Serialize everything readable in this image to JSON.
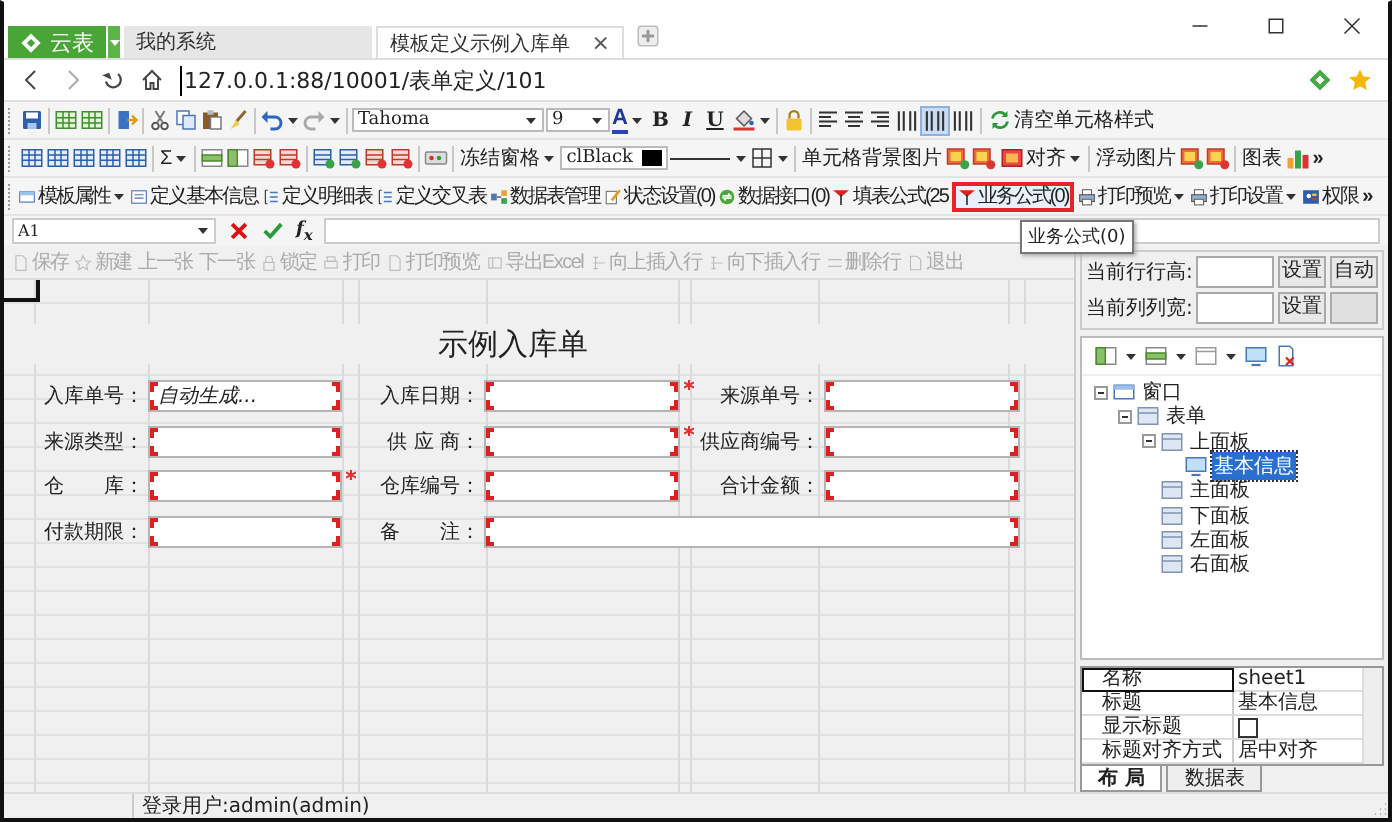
{
  "app_button": {
    "label": "云表"
  },
  "browser_tabs": [
    {
      "label": "我的系统",
      "selected": false
    },
    {
      "label": "模板定义示例入库单",
      "selected": true,
      "close": "×"
    }
  ],
  "address": {
    "url": "127.0.0.1:88/10001/表单定义/101"
  },
  "format_toolbar": {
    "font": "Tahoma",
    "size": "9",
    "font_color": "A",
    "bold": "B",
    "italic": "I",
    "underline": "U",
    "clear_format": "清空单元格样式",
    "vertical_align": [
      {
        "selected": false
      },
      {
        "selected": true
      },
      {
        "selected": false
      }
    ]
  },
  "sheet_toolbar": {
    "sum": "Σ",
    "freeze": "冻结窗格",
    "color_name": "clBlack",
    "cell_background": "单元格背景图片",
    "align": "对齐",
    "float_image": "浮动图片",
    "chart": "图表",
    "more": "»"
  },
  "template_toolbar": {
    "items": [
      {
        "label": "模板属性",
        "dropdown": true,
        "highlighted": false
      },
      {
        "label": "定义基本信息",
        "dropdown": false,
        "highlighted": false
      },
      {
        "label": "定义明细表",
        "dropdown": false,
        "highlighted": false
      },
      {
        "label": "定义交叉表",
        "dropdown": false,
        "highlighted": false
      },
      {
        "label": "数据表管理",
        "dropdown": false,
        "highlighted": false
      },
      {
        "label": "状态设置(0)",
        "dropdown": false,
        "highlighted": false
      },
      {
        "label": "数据接口(0)",
        "dropdown": false,
        "highlighted": false
      },
      {
        "label": "填表公式(25",
        "dropdown": false,
        "highlighted": false
      },
      {
        "label": "业务公式(0)",
        "dropdown": false,
        "highlighted": true
      },
      {
        "label": "打印预览",
        "dropdown": true,
        "highlighted": false
      },
      {
        "label": "打印设置",
        "dropdown": true,
        "highlighted": false
      },
      {
        "label": "权限",
        "dropdown": false,
        "highlighted": false
      }
    ],
    "more": "»"
  },
  "formula_bar": {
    "cell": "A1",
    "fx": "f$_{x}$"
  },
  "tooltip": "业务公式(0)",
  "form_toolbar": [
    {
      "label": "保存",
      "disabled": true
    },
    {
      "label": "新建",
      "disabled": true
    },
    {
      "label": "上一张",
      "disabled": true
    },
    {
      "label": "下一张",
      "disabled": true
    },
    {
      "label": "锁定",
      "disabled": true
    },
    {
      "label": "打印",
      "disabled": true
    },
    {
      "label": "打印预览",
      "disabled": true
    },
    {
      "label": "导出Excel",
      "disabled": true
    },
    {
      "label": "向上插入行",
      "disabled": true
    },
    {
      "label": "向下插入行",
      "disabled": true
    },
    {
      "label": "删除行",
      "disabled": true
    },
    {
      "label": "退出",
      "disabled": true
    }
  ],
  "form": {
    "title": "示例入库单",
    "fields": [
      {
        "label": "入库单号：",
        "value": "自动生成...",
        "required": false,
        "wide": false
      },
      {
        "label": "入库日期：",
        "required": true,
        "wide": false
      },
      {
        "label": "来源单号：",
        "required": false,
        "wide": false
      },
      {
        "label": "来源类型：",
        "required": false,
        "wide": false
      },
      {
        "label": "供 应 商：",
        "required": true,
        "wide": false
      },
      {
        "label": "供应商编号：",
        "required": false,
        "wide": false
      },
      {
        "label": "仓　　库：",
        "required": true,
        "wide": false
      },
      {
        "label": "仓库编号：",
        "required": false,
        "wide": false
      },
      {
        "label": "合计金额：",
        "required": false,
        "wide": false
      },
      {
        "label": "付款期限：",
        "required": false,
        "wide": false
      },
      {
        "label": "备　　注：",
        "required": false,
        "wide": true
      }
    ]
  },
  "size_settings": [
    {
      "label": "当前行行高:",
      "button": "设置",
      "extra": "自动"
    },
    {
      "label": "当前列列宽:",
      "button": "设置"
    }
  ],
  "tree": [
    {
      "label": "窗口",
      "expanded": true,
      "selected": false,
      "children": [
        {
          "label": "表单",
          "expanded": true,
          "selected": false,
          "children": [
            {
              "label": "上面板",
              "expanded": true,
              "selected": false,
              "children": [
                {
                  "label": "基本信息",
                  "selected": true
                }
              ]
            },
            {
              "label": "主面板",
              "selected": false
            },
            {
              "label": "下面板",
              "selected": false
            },
            {
              "label": "左面板",
              "selected": false
            },
            {
              "label": "右面板",
              "selected": false
            }
          ]
        }
      ]
    }
  ],
  "properties": [
    {
      "name": "名称",
      "kind": "text",
      "value": "sheet1",
      "selected": true
    },
    {
      "name": "标题",
      "kind": "text",
      "value": "基本信息",
      "selected": false
    },
    {
      "name": "显示标题",
      "kind": "checkbox",
      "checked": false,
      "selected": false
    },
    {
      "name": "标题对齐方式",
      "kind": "text",
      "value": "居中对齐",
      "selected": false
    }
  ],
  "panel_tabs": [
    {
      "label": "布 局",
      "selected": true
    },
    {
      "label": "数据表",
      "selected": false
    }
  ],
  "status_bar": {
    "user": "登录用户:admin(admin)"
  }
}
